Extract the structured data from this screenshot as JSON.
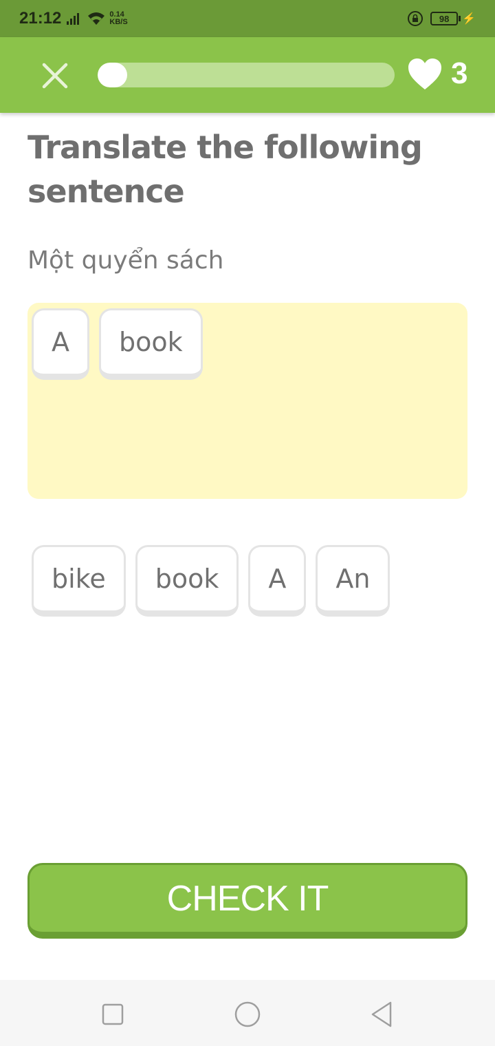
{
  "status_bar": {
    "time": "21:12",
    "net_speed_value": "0.14",
    "net_speed_unit": "KB/S",
    "battery_level": "98",
    "icons": [
      "signal-icon",
      "wifi-icon",
      "rotation-lock-icon",
      "battery-icon",
      "charging-icon"
    ]
  },
  "header": {
    "progress_fraction": 0.1,
    "lives": "3",
    "icons": [
      "close-icon",
      "heart-icon"
    ]
  },
  "exercise": {
    "title": "Translate the following sentence",
    "source_sentence": "Một quyển sách",
    "answer_tiles": [
      "A",
      "book"
    ],
    "word_bank": [
      "bike",
      "book",
      "A",
      "An"
    ],
    "check_label": "CHECK IT"
  },
  "nav_bar": {
    "icons": [
      "recent-apps-icon",
      "home-icon",
      "back-icon"
    ]
  },
  "colors": {
    "status_bar_bg": "#6b9a37",
    "accent_green": "#8bc34a",
    "answer_area_bg": "#fff9c4",
    "text_gray": "#6f6f6f"
  }
}
